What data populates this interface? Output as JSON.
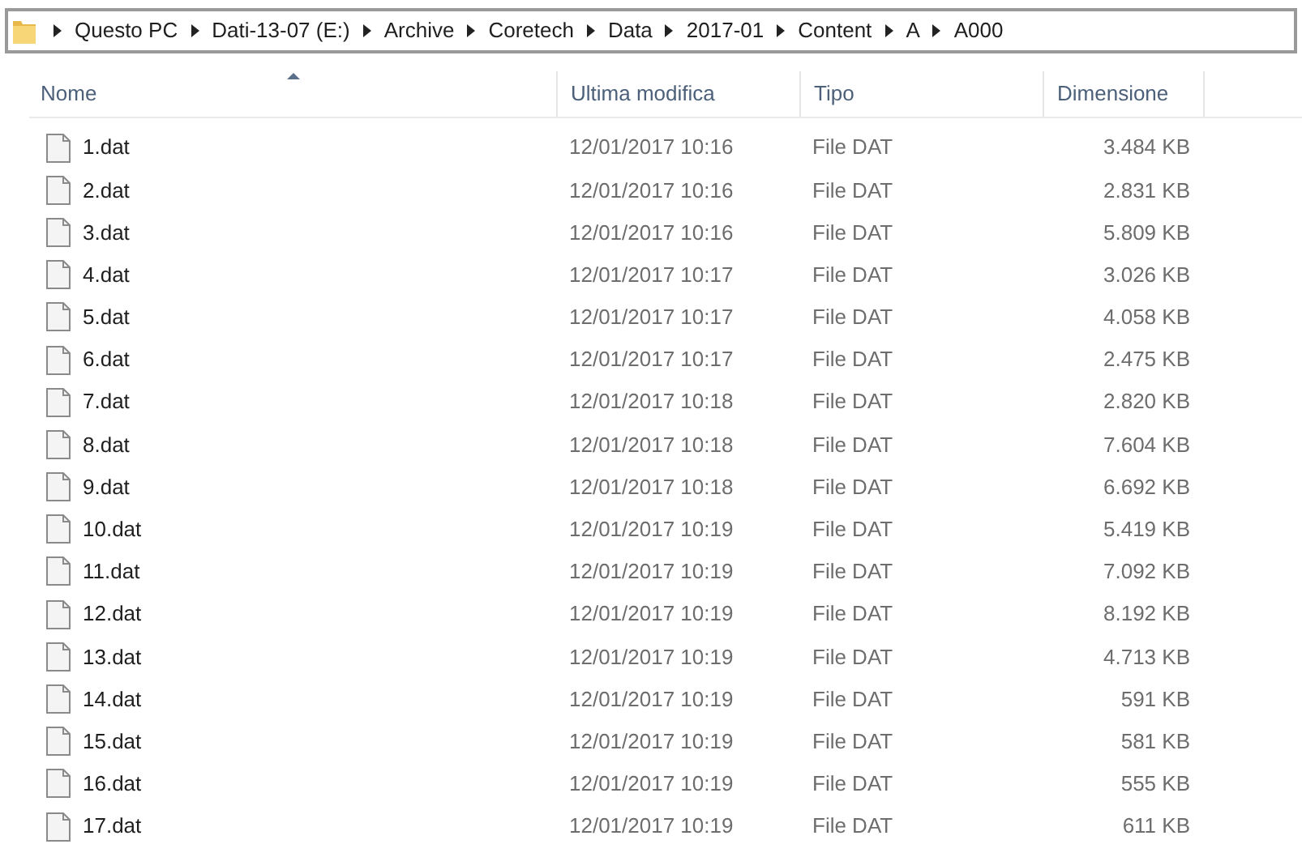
{
  "address_bar": {
    "path": [
      "Questo PC",
      "Dati-13-07 (E:)",
      "Archive",
      "Coretech",
      "Data",
      "2017-01",
      "Content",
      "A",
      "A000"
    ]
  },
  "table": {
    "columns": [
      {
        "label": "Nome",
        "sorted": true
      },
      {
        "label": "Ultima modifica",
        "sorted": false
      },
      {
        "label": "Tipo",
        "sorted": false
      },
      {
        "label": "Dimensione",
        "sorted": false
      }
    ],
    "rows": [
      {
        "name": "1.dat",
        "modified": "12/01/2017 10:16",
        "type": "File DAT",
        "size": "3.484 KB"
      },
      {
        "name": "2.dat",
        "modified": "12/01/2017 10:16",
        "type": "File DAT",
        "size": "2.831 KB"
      },
      {
        "name": "3.dat",
        "modified": "12/01/2017 10:16",
        "type": "File DAT",
        "size": "5.809 KB"
      },
      {
        "name": "4.dat",
        "modified": "12/01/2017 10:17",
        "type": "File DAT",
        "size": "3.026 KB"
      },
      {
        "name": "5.dat",
        "modified": "12/01/2017 10:17",
        "type": "File DAT",
        "size": "4.058 KB"
      },
      {
        "name": "6.dat",
        "modified": "12/01/2017 10:17",
        "type": "File DAT",
        "size": "2.475 KB"
      },
      {
        "name": "7.dat",
        "modified": "12/01/2017 10:18",
        "type": "File DAT",
        "size": "2.820 KB"
      },
      {
        "name": "8.dat",
        "modified": "12/01/2017 10:18",
        "type": "File DAT",
        "size": "7.604 KB"
      },
      {
        "name": "9.dat",
        "modified": "12/01/2017 10:18",
        "type": "File DAT",
        "size": "6.692 KB"
      },
      {
        "name": "10.dat",
        "modified": "12/01/2017 10:19",
        "type": "File DAT",
        "size": "5.419 KB"
      },
      {
        "name": "11.dat",
        "modified": "12/01/2017 10:19",
        "type": "File DAT",
        "size": "7.092 KB"
      },
      {
        "name": "12.dat",
        "modified": "12/01/2017 10:19",
        "type": "File DAT",
        "size": "8.192 KB"
      },
      {
        "name": "13.dat",
        "modified": "12/01/2017 10:19",
        "type": "File DAT",
        "size": "4.713 KB"
      },
      {
        "name": "14.dat",
        "modified": "12/01/2017 10:19",
        "type": "File DAT",
        "size": "591 KB"
      },
      {
        "name": "15.dat",
        "modified": "12/01/2017 10:19",
        "type": "File DAT",
        "size": "581 KB"
      },
      {
        "name": "16.dat",
        "modified": "12/01/2017 10:19",
        "type": "File DAT",
        "size": "555 KB"
      },
      {
        "name": "17.dat",
        "modified": "12/01/2017 10:19",
        "type": "File DAT",
        "size": "611 KB"
      }
    ]
  }
}
